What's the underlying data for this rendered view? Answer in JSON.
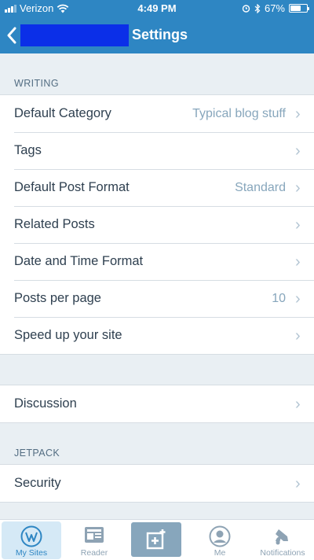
{
  "status_bar": {
    "carrier": "Verizon",
    "time": "4:49 PM",
    "battery": "67%",
    "battery_level": 0.67
  },
  "nav": {
    "site_name": "",
    "title": "Settings"
  },
  "sections": {
    "writing_header": "WRITING",
    "writing_rows": [
      {
        "label": "Default Category",
        "value": "Typical blog stuff"
      },
      {
        "label": "Tags",
        "value": ""
      },
      {
        "label": "Default Post Format",
        "value": "Standard"
      },
      {
        "label": "Related Posts",
        "value": ""
      },
      {
        "label": "Date and Time Format",
        "value": ""
      },
      {
        "label": "Posts per page",
        "value": "10"
      },
      {
        "label": "Speed up your site",
        "value": ""
      }
    ],
    "discussion_label": "Discussion",
    "jetpack_header": "JETPACK",
    "security_label": "Security"
  },
  "tabs": [
    {
      "label": "My Sites",
      "icon": "wordpress-icon",
      "active": true
    },
    {
      "label": "Reader",
      "icon": "reader-icon",
      "active": false
    },
    {
      "label": "",
      "icon": "write-post-icon",
      "active": false
    },
    {
      "label": "Me",
      "icon": "me-icon",
      "active": false
    },
    {
      "label": "Notifications",
      "icon": "bell-icon",
      "active": false
    }
  ],
  "colors": {
    "brand_blue": "#2e86c3",
    "background": "#e9eff3",
    "redaction": "#0b2fe8"
  }
}
